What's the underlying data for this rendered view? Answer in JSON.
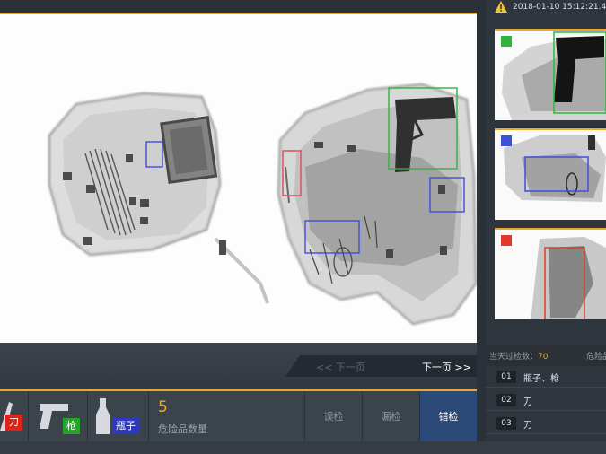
{
  "header": {
    "datetime": "2018-01-10   15:12:21.4"
  },
  "main_view": {
    "detections": [
      {
        "color": "#2fb53a",
        "type": "gun"
      },
      {
        "color": "#3d4fd9",
        "type": "bottle"
      },
      {
        "color": "#d85a6a",
        "type": "knife"
      }
    ]
  },
  "pager": {
    "prev_label": "<< 下一页",
    "next_label": "下一页 >>"
  },
  "categories": [
    {
      "label": "刀",
      "color": "#d9231b",
      "icon": "knife-icon"
    },
    {
      "label": "枪",
      "color": "#27a32b",
      "icon": "gun-icon"
    },
    {
      "label": "瓶子",
      "color": "#2d3ac0",
      "icon": "bottle-icon"
    }
  ],
  "hazard": {
    "count": "5",
    "label": "危险品数量"
  },
  "actions": [
    {
      "label": "误检",
      "active": false
    },
    {
      "label": "漏检",
      "active": false
    },
    {
      "label": "错检",
      "active": true
    }
  ],
  "thumbnails": [
    {
      "color": "#2fb53a",
      "type": "gun"
    },
    {
      "color": "#3d4fd9",
      "type": "bottle"
    },
    {
      "color": "#e23a2a",
      "type": "knife"
    }
  ],
  "stats": {
    "label": "当天过检数：",
    "value": "70",
    "label2": "危险品"
  },
  "detection_list": [
    {
      "num": "01",
      "text": "瓶子、枪"
    },
    {
      "num": "02",
      "text": "刀"
    },
    {
      "num": "03",
      "text": "刀"
    }
  ],
  "colors": {
    "accent": "#e9a92a",
    "active_button": "#2c4a78"
  }
}
